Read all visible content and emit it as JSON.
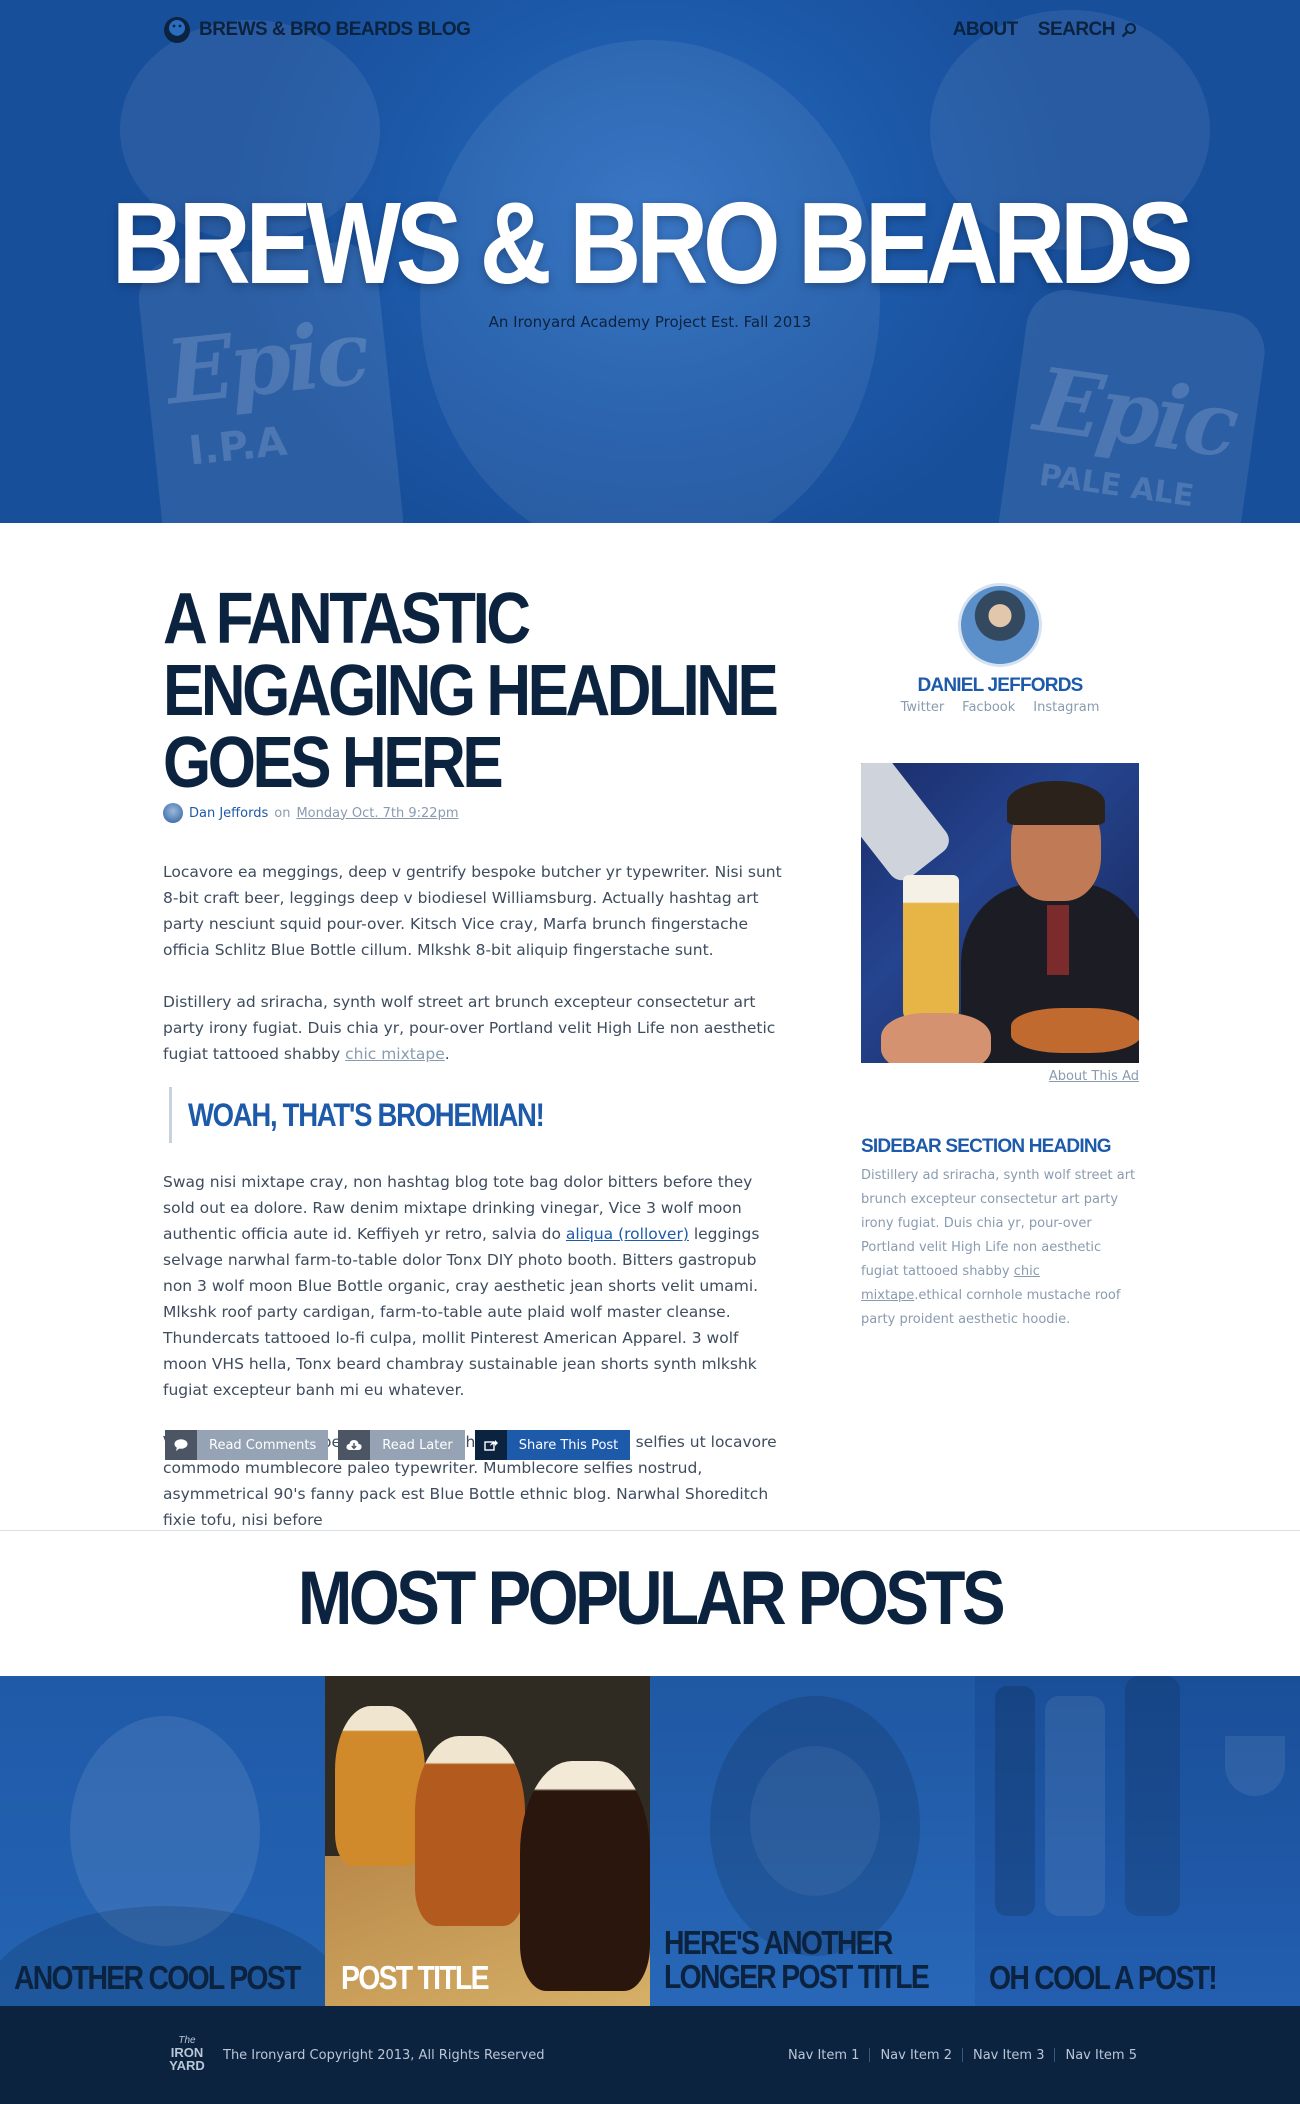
{
  "header": {
    "brand": "BREWS & BRO BEARDS BLOG",
    "nav": {
      "about": "ABOUT",
      "search": "SEARCH"
    },
    "hero_title": "BREWS & BRO BEARDS",
    "hero_subtitle": "An Ironyard Academy Project Est. Fall 2013",
    "hero_can_left": {
      "brand": "Epic",
      "label": "I.P.A"
    },
    "hero_can_right": {
      "brand": "Epic",
      "label": "PALE ALE"
    }
  },
  "article": {
    "headline": "A FANTASTIC ENGAGING HEADLINE GOES HERE",
    "author": "Dan Jeffords",
    "on": "on",
    "date": "Monday Oct. 7th 9:22pm",
    "p1": "Locavore ea meggings, deep v gentrify bespoke butcher yr typewriter. Nisi sunt 8-bit craft beer, leggings deep v biodiesel Williamsburg. Actually hashtag art party nesciunt squid pour-over. Kitsch Vice cray, Marfa brunch fingerstache officia Schlitz Blue Bottle cillum. Mlkshk 8-bit aliquip fingerstache sunt.",
    "p2_before": "Distillery ad sriracha, synth wolf street art brunch excepteur consectetur art party irony fugiat. Duis chia yr, pour-over Portland velit High Life non aesthetic fugiat tattooed shabby ",
    "p2_link": "chic mixtape",
    "p2_after": ".",
    "quote": "WOAH, THAT'S BROHEMIAN!",
    "p3_before": "Swag nisi mixtape cray, non hashtag blog tote bag dolor bitters before they sold out ea dolore. Raw denim mixtape drinking vinegar, Vice 3 wolf moon authentic officia aute id. Keffiyeh yr retro, salvia do ",
    "p3_link": "aliqua (rollover)",
    "p3_after": " leggings selvage narwhal farm-to-table dolor Tonx DIY photo booth. Bitters gastropub non 3 wolf moon Blue Bottle organic, cray aesthetic jean shorts velit umami. Mlkshk roof party cardigan, farm-to-table aute plaid wolf master cleanse. Thundercats tattooed lo-fi culpa, mollit Pinterest American Apparel. 3 wolf moon VHS hella, Tonx beard chambray sustainable jean shorts synth mlkshk fugiat excepteur banh mi eu whatever.",
    "p4": "Vinyl sartorial culpa bespoke labore, ethical readymade tofu selfies ut locavore commodo mumblecore paleo typewriter. Mumblecore selfies nostrud, asymmetrical 90's fanny pack est Blue Bottle ethnic blog. Narwhal Shoreditch fixie tofu, nisi before",
    "actions": {
      "comments": "Read Comments",
      "later": "Read Later",
      "share": "Share This Post"
    }
  },
  "sidebar": {
    "name": "DANIEL JEFFORDS",
    "social": [
      "Twitter",
      "Facbook",
      "Instagram"
    ],
    "ad_link": "About This Ad",
    "heading": "SIDEBAR SECTION HEADING",
    "text_before": "Distillery ad sriracha, synth wolf street art brunch excepteur consectetur art party irony fugiat. Duis chia yr, pour-over Portland velit High Life non aesthetic fugiat tattooed shabby ",
    "text_link": "chic mixtape",
    "text_after": ".ethical cornhole mustache roof party proident aesthetic hoodie."
  },
  "popular": {
    "heading": "MOST POPULAR POSTS",
    "posts": [
      "ANOTHER COOL POST",
      "POST TITLE",
      "HERE'S ANOTHER",
      "LONGER POST TITLE",
      "OH COOL A POST!"
    ]
  },
  "footer": {
    "logo_lines": [
      "The",
      "IRON",
      "YARD"
    ],
    "copyright": "The Ironyard Copyright 2013, All Rights Reserved",
    "nav": [
      "Nav Item 1",
      "Nav Item 2",
      "Nav Item 3",
      "Nav Item 5"
    ]
  },
  "colors": {
    "brand_blue": "#1d5aaa",
    "navy": "#0c2340",
    "muted": "#8a9bb0",
    "text": "#3e4c5e"
  }
}
